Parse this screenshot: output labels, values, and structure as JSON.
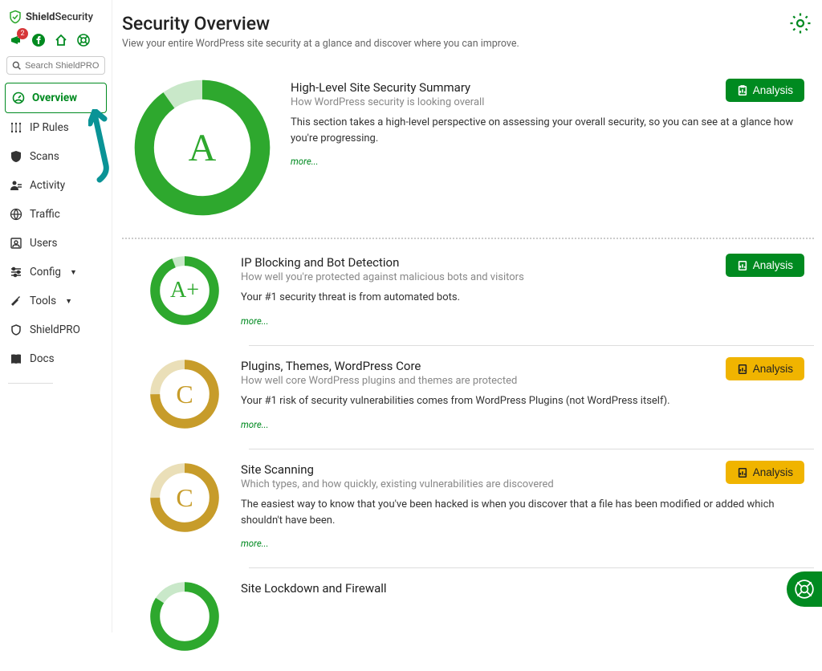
{
  "brand": {
    "name_bold": "Shield",
    "name_light": "Security"
  },
  "top_icons": {
    "badge_count": "2"
  },
  "search": {
    "placeholder": "Search ShieldPRO"
  },
  "nav": {
    "overview": "Overview",
    "ip_rules": "IP Rules",
    "scans": "Scans",
    "activity": "Activity",
    "traffic": "Traffic",
    "users": "Users",
    "config": "Config",
    "tools": "Tools",
    "shieldpro": "ShieldPRO",
    "docs": "Docs"
  },
  "page": {
    "title": "Security Overview",
    "subtitle": "View your entire WordPress site security at a glance and discover where you can improve."
  },
  "buttons": {
    "analysis": "Analysis"
  },
  "colors": {
    "green": "#008a20",
    "bright_green": "#2ea82e",
    "amber": "#c79c2a",
    "yellow_btn": "#f0b400"
  },
  "cards": {
    "summary": {
      "grade": "A",
      "title": "High-Level Site Security Summary",
      "subtitle": "How WordPress security is looking overall",
      "desc": "This section takes a high-level perspective on assessing your overall security, so you can see at a glance how you're progressing.",
      "more": "more..."
    },
    "ip": {
      "grade": "A+",
      "title": "IP Blocking and Bot Detection",
      "subtitle": "How well you're protected against malicious bots and visitors",
      "desc": "Your #1 security threat is from automated bots.",
      "more": "more..."
    },
    "plugins": {
      "grade": "C",
      "title": "Plugins, Themes, WordPress Core",
      "subtitle": "How well core WordPress plugins and themes are protected",
      "desc": "Your #1 risk of security vulnerabilities comes from WordPress Plugins (not WordPress itself).",
      "more": "more..."
    },
    "scanning": {
      "grade": "C",
      "title": "Site Scanning",
      "subtitle": "Which types, and how quickly, existing vulnerabilities are discovered",
      "desc": "The easiest way to know that you've been hacked is when you discover that a file has been modified or added which shouldn't have been.",
      "more": "more..."
    },
    "lockdown": {
      "title": "Site Lockdown and Firewall"
    }
  }
}
